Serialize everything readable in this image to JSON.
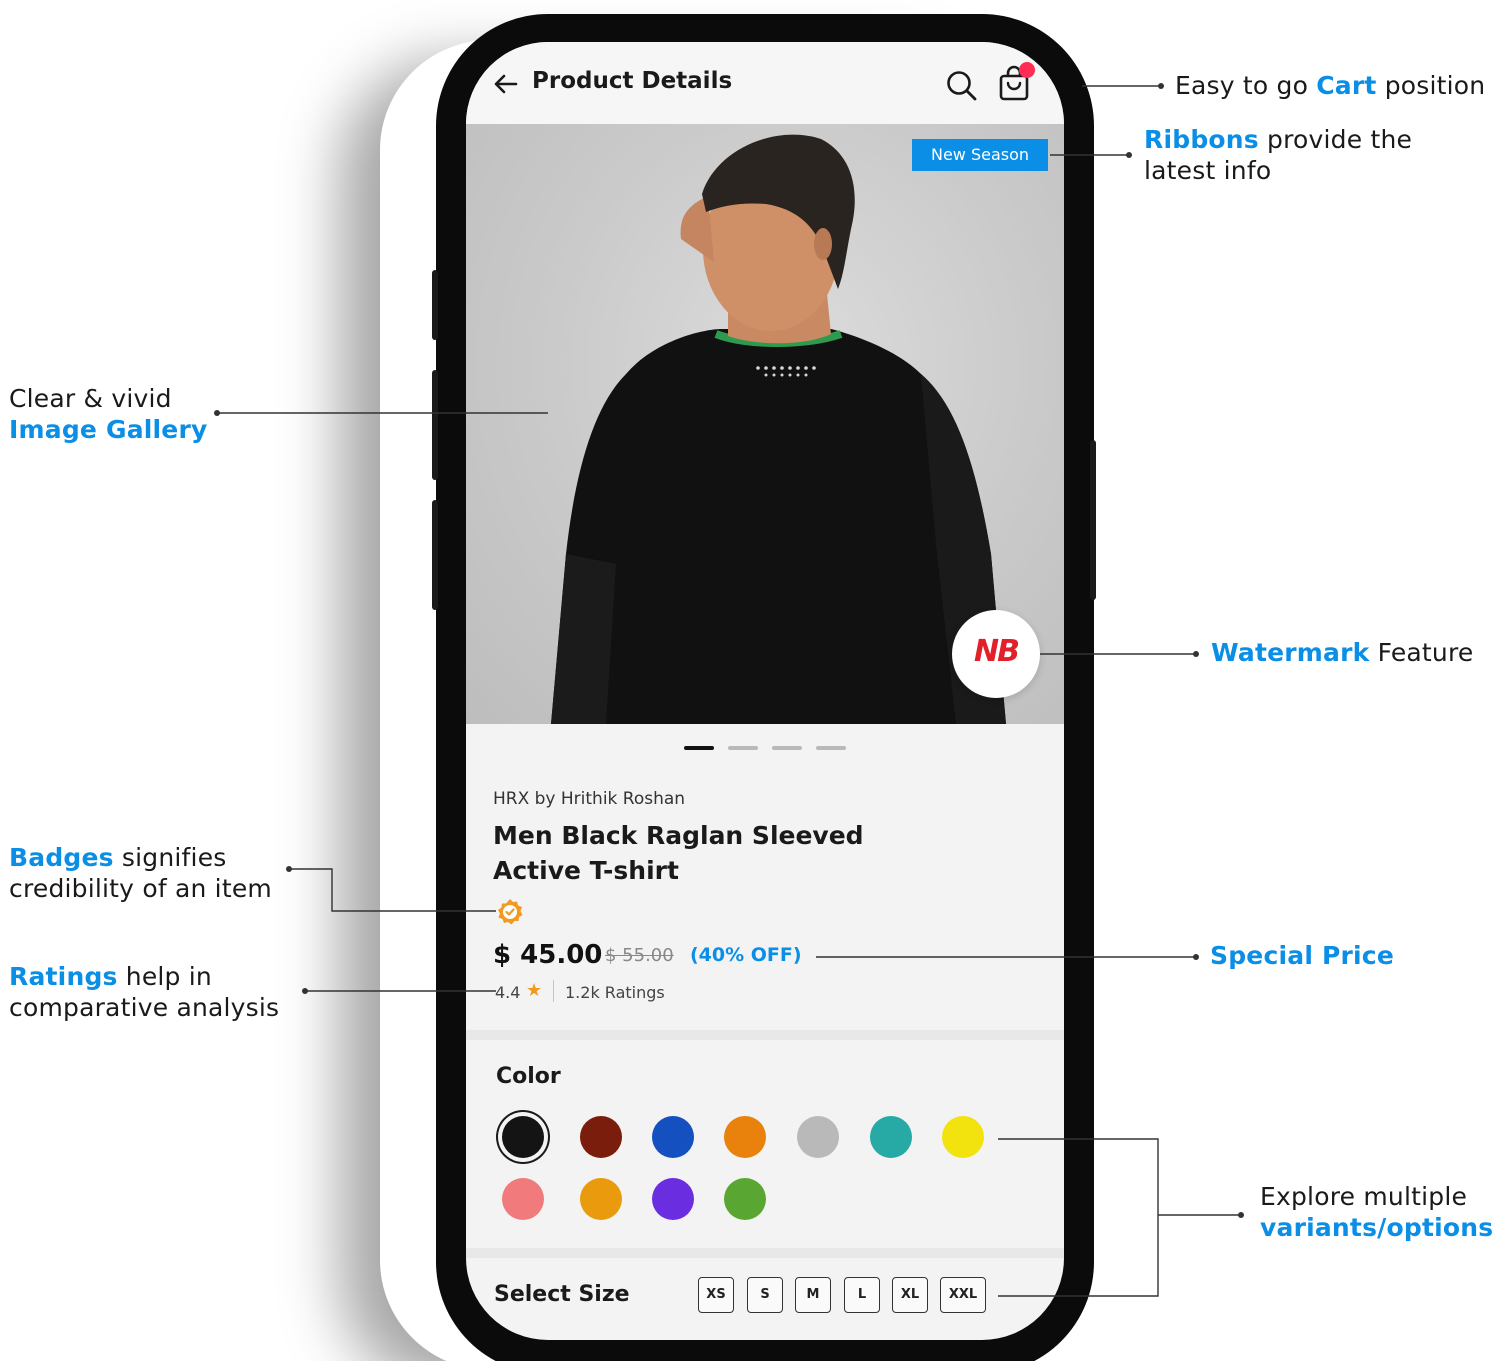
{
  "screen": {
    "title": "Product Details",
    "ribbon": "New Season",
    "watermark_text": "NB",
    "gallery_dots": [
      {
        "active": true
      },
      {
        "active": false
      },
      {
        "active": false
      },
      {
        "active": false
      }
    ],
    "product": {
      "brand": "HRX by Hrithik Roshan",
      "name_line1": "Men Black Raglan Sleeved",
      "name_line2": "Active T-shirt",
      "price": "$ 45.00",
      "mrp": "$ 55.00",
      "discount": "(40% OFF)",
      "rating": "4.4",
      "ratings_count": "1.2k Ratings"
    },
    "color_label": "Color",
    "colors": [
      "#141414",
      "#7a1d0c",
      "#1450c0",
      "#e8820c",
      "#b9b9b9",
      "#27aaa5",
      "#f2e20e",
      "#f17a7c",
      "#e99b0d",
      "#6a2ee0",
      "#5aa632"
    ],
    "selected_color": "#141414",
    "size_label": "Select Size",
    "sizes": [
      "XS",
      "S",
      "M",
      "L",
      "XL",
      "XXL"
    ]
  },
  "callouts": {
    "cart": {
      "pre": "Easy to go ",
      "hl": "Cart",
      "post": " position"
    },
    "ribbons": {
      "hl": "Ribbons",
      "post": " provide the",
      "line2": "latest info"
    },
    "gallery": {
      "line1": "Clear & vivid",
      "hl": "Image Gallery"
    },
    "watermark": {
      "hl": "Watermark",
      "post": " Feature"
    },
    "badges": {
      "hl": "Badges",
      "post": " signifies",
      "line2": "credibility of an item"
    },
    "ratings": {
      "hl": "Ratings",
      "post": " help in",
      "line2": "comparative analysis"
    },
    "special": {
      "hl": "Special Price"
    },
    "variants": {
      "line1": "Explore multiple",
      "hl": "variants/options"
    }
  },
  "colors": {
    "accent": "#0a8ee6",
    "phone_frame": "#0b0b0b",
    "brand_logo": "#e2202a",
    "cart_dot": "#ff2d55",
    "star": "#f29a1f"
  }
}
